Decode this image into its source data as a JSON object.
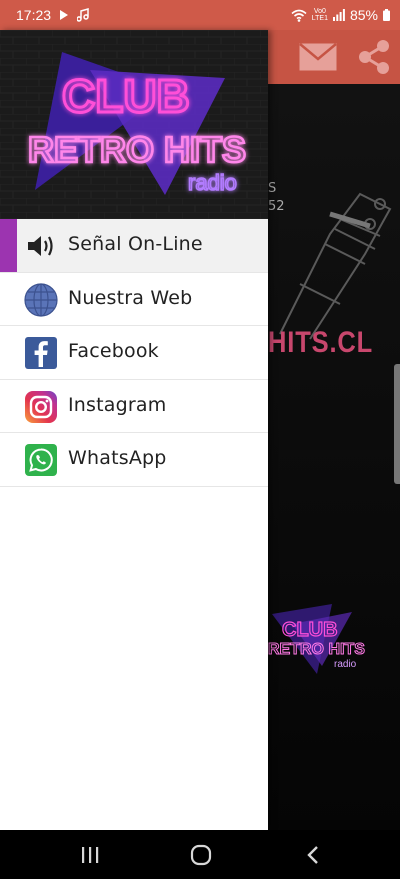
{
  "status_bar": {
    "time": "17:23",
    "volte_line1": "Vo0",
    "volte_line2": "LTE1",
    "battery": "85%"
  },
  "app": {
    "background_text": "HITS.CL",
    "background_small_1": "S",
    "background_small_2": "52"
  },
  "drawer": {
    "logo": {
      "line1": "CLUB",
      "line2": "RETRO HITS",
      "line3": "radio"
    },
    "menu": [
      {
        "label": "Señal On-Line",
        "icon": "speaker-icon"
      },
      {
        "label": "Nuestra Web",
        "icon": "globe-icon"
      },
      {
        "label": "Facebook",
        "icon": "facebook-icon"
      },
      {
        "label": "Instagram",
        "icon": "instagram-icon"
      },
      {
        "label": "WhatsApp",
        "icon": "whatsapp-icon"
      }
    ]
  },
  "colors": {
    "status_bar": "#cf5a49",
    "toolbar": "#c65444",
    "active_indicator": "#9c34b0",
    "neon_pink": "#ff4fd8",
    "neon_purple": "#7b35d6"
  }
}
